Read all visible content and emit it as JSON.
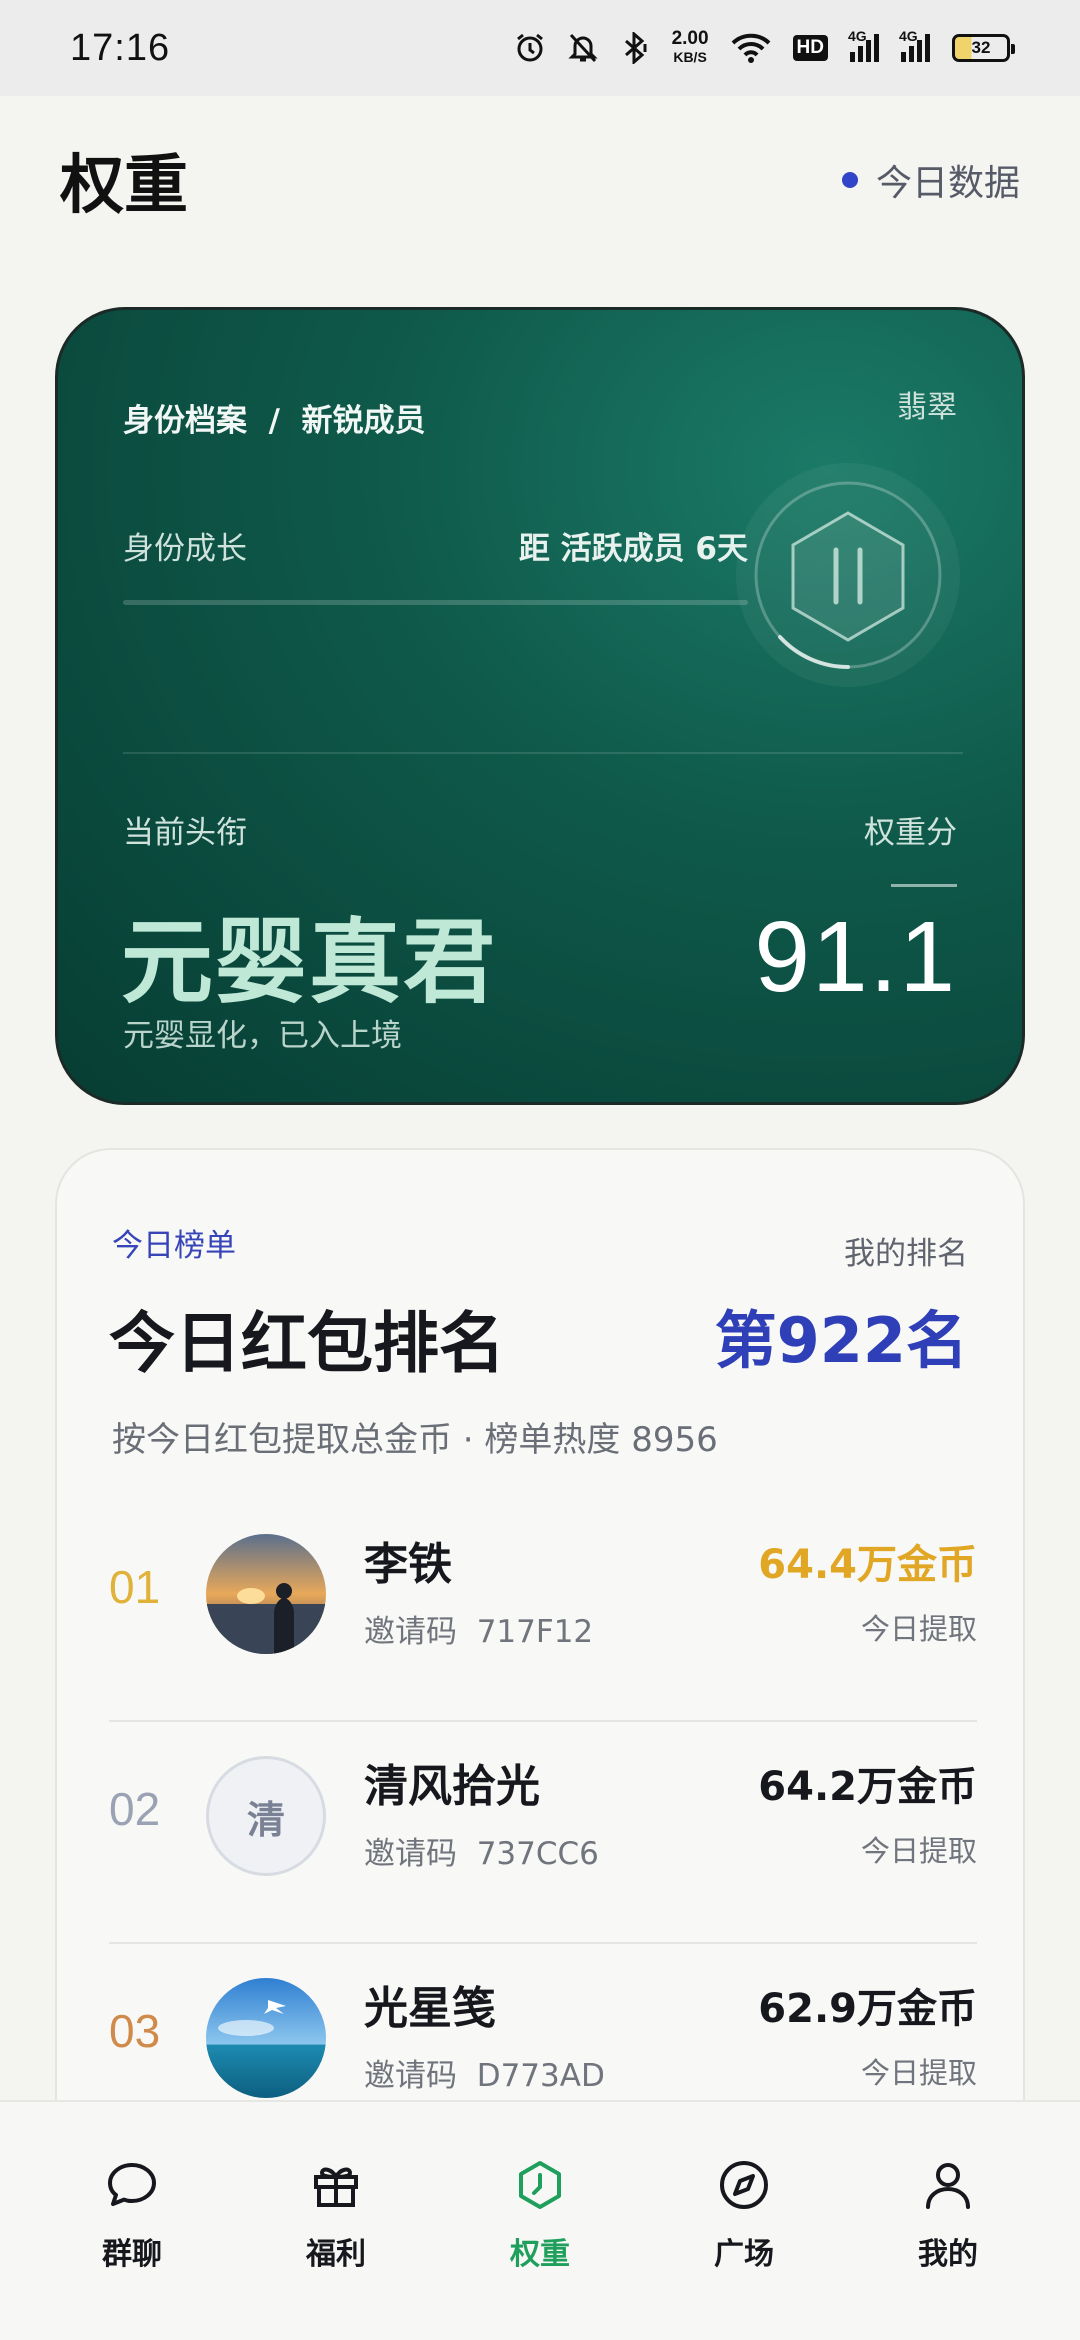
{
  "status_bar": {
    "time": "17:16",
    "net_speed_value": "2.00",
    "net_speed_unit": "KB/S",
    "hd": "HD",
    "signal1_label": "4G",
    "signal2_label": "4G",
    "battery": "32"
  },
  "header": {
    "title": "权重",
    "today_data": "今日数据"
  },
  "identity": {
    "breadcrumb": "身份档案  /  新锐成员",
    "grade": "翡翠",
    "growth_label": "身份成长",
    "growth_distance": "距 活跃成员 6天",
    "growth_progress": 0.0,
    "current_title_label": "当前头衔",
    "score_label": "权重分",
    "current_title": "元婴真君",
    "score": "91.1",
    "title_desc": "元婴显化，已入上境"
  },
  "ranking": {
    "kicker": "今日榜单",
    "my_rank_label": "我的排名",
    "title": "今日红包排名",
    "my_rank": "第922名",
    "subtitle": "按今日红包提取总金币 · 榜单热度 8956",
    "rows": [
      {
        "num": "01",
        "name": "李铁",
        "code": "邀请码  717F12",
        "coins": "64.4万金币",
        "note": "今日提取",
        "num_color": "#e0b23a"
      },
      {
        "num": "02",
        "name": "清风拾光",
        "code": "邀请码  737CC6",
        "coins": "64.2万金币",
        "note": "今日提取",
        "num_color": "#9aa2b3",
        "avatar_text": "清"
      },
      {
        "num": "03",
        "name": "光星笺",
        "code": "邀请码  D773AD",
        "coins": "62.9万金币",
        "note": "今日提取",
        "num_color": "#d08a4a"
      }
    ]
  },
  "tabbar": {
    "tabs": [
      {
        "label": "群聊",
        "icon": "chat-bubble-icon"
      },
      {
        "label": "福利",
        "icon": "gift-icon"
      },
      {
        "label": "权重",
        "icon": "weight-hexagon-icon",
        "active": true
      },
      {
        "label": "广场",
        "icon": "compass-icon"
      },
      {
        "label": "我的",
        "icon": "person-icon"
      }
    ]
  },
  "colors": {
    "accent_blue": "#2f3fb8",
    "active_green": "#1e9f5b",
    "card_green": "#0f5a4b",
    "gold": "#e0a624"
  }
}
